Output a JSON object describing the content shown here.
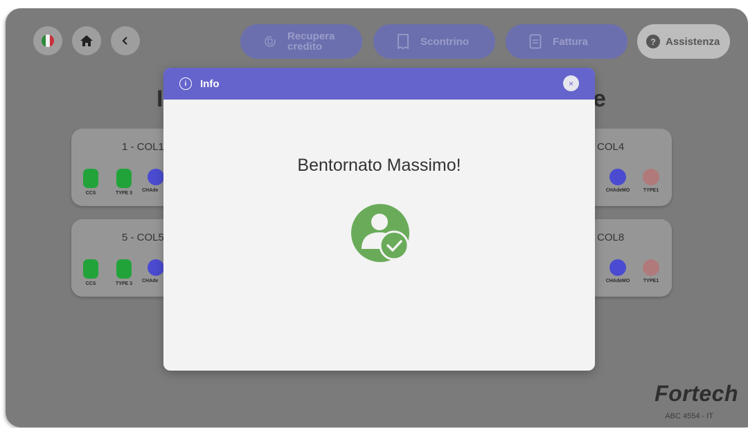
{
  "nav": {
    "flag_icon": "italy-flag-icon",
    "home_icon": "home-icon",
    "back_icon": "chevron-left-icon"
  },
  "actions": {
    "recupera_label_line1": "Recupera",
    "recupera_label_line2": "credito",
    "scontrino_label": "Scontrino",
    "fattura_label": "Fattura",
    "assistenza_label": "Assistenza"
  },
  "background": {
    "heading_left": "I",
    "heading_right": "e",
    "cards": [
      {
        "title": "1 - COL1"
      },
      {
        "title": "COL4"
      },
      {
        "title": "5 - COL5"
      },
      {
        "title": "COL8"
      }
    ],
    "connectors": {
      "ccs": "CCS",
      "type3": "TYPE 3",
      "chademo_short": "CHAde",
      "chademo": "CHAdeMO",
      "type1": "TYPE1"
    },
    "brand": "Fortech",
    "plate": "ABC 4554 - IT"
  },
  "modal": {
    "title": "Info",
    "close_symbol": "×",
    "message": "Bentornato Massimo!",
    "icon": "user-check-icon"
  },
  "colors": {
    "accent": "#6564cc",
    "success": "#6aab5a",
    "ccs_green": "#22a33a",
    "chademo_blue": "#4a4bd0",
    "type1_rose": "#b07a7a"
  }
}
